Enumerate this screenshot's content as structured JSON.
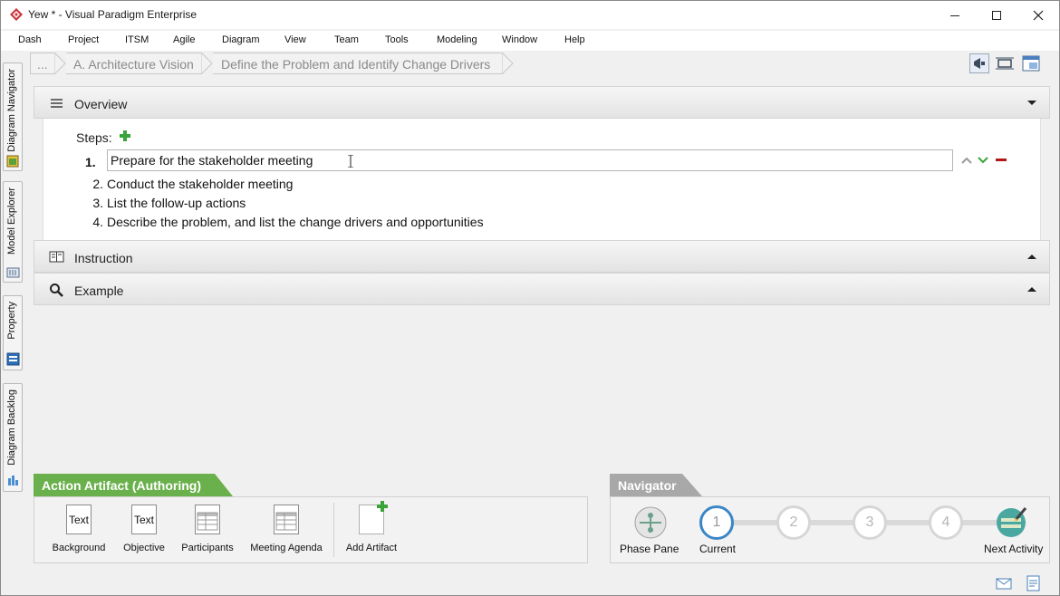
{
  "window": {
    "title": "Yew * - Visual Paradigm Enterprise",
    "controls": [
      "minimize-icon",
      "maximize-icon",
      "close-icon"
    ]
  },
  "menu": [
    "Dash",
    "Project",
    "ITSM",
    "Agile",
    "Diagram",
    "View",
    "Team",
    "Tools",
    "Modeling",
    "Window",
    "Help"
  ],
  "sidebar": {
    "tabs": [
      {
        "label": "Diagram Navigator",
        "icon": "diagram-navigator-icon"
      },
      {
        "label": "Model Explorer",
        "icon": "model-explorer-icon"
      },
      {
        "label": "Property",
        "icon": "property-icon"
      },
      {
        "label": "Diagram Backlog",
        "icon": "diagram-backlog-icon"
      }
    ]
  },
  "breadcrumb": {
    "items": [
      "...",
      "A. Architecture Vision",
      "Define the Problem and Identify Change Drivers"
    ]
  },
  "toolbar_icons": [
    "announce-icon",
    "fit-view-icon",
    "panel-layout-icon"
  ],
  "overview": {
    "title": "Overview",
    "icon": "list-menu-icon",
    "steps_label": "Steps:",
    "steps": [
      {
        "num": "1.",
        "text": "Prepare for the stakeholder meeting",
        "editing": true
      },
      {
        "num": "2.",
        "text": "Conduct the stakeholder meeting"
      },
      {
        "num": "3.",
        "text": "List the follow-up actions"
      },
      {
        "num": "4.",
        "text": "Describe the problem, and list the change drivers and opportunities"
      }
    ]
  },
  "instruction": {
    "title": "Instruction",
    "icon": "book-icon"
  },
  "example": {
    "title": "Example",
    "icon": "magnifier-icon"
  },
  "action_artifact": {
    "title": "Action Artifact (Authoring)",
    "color": "#6ab04c",
    "items": [
      {
        "label": "Background",
        "doc_text": "Text"
      },
      {
        "label": "Objective",
        "doc_text": "Text"
      },
      {
        "label": "Participants",
        "doc_text": ""
      },
      {
        "label": "Meeting Agenda",
        "doc_text": ""
      }
    ],
    "add_label": "Add Artifact"
  },
  "navigator": {
    "title": "Navigator",
    "color": "#a8a8a8",
    "phase_pane_label": "Phase Pane",
    "steps": [
      "1",
      "2",
      "3",
      "4"
    ],
    "current_label": "Current",
    "next_label": "Next Activity"
  },
  "status_icons": [
    "mail-icon",
    "notes-icon"
  ]
}
